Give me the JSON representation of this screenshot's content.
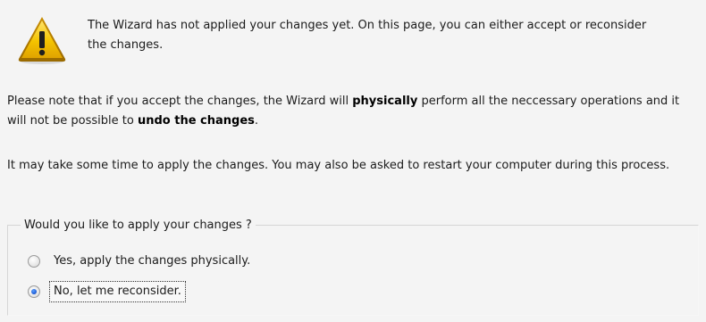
{
  "intro": {
    "text": "The Wizard has not applied your changes yet. On this page, you can either accept or reconsider the changes."
  },
  "note": {
    "part1": "Please note that if you accept the changes, the Wizard will ",
    "bold1": "physically",
    "part2": " perform all the neccessary operations and it will not be possible to ",
    "bold2": "undo the changes",
    "part3": "."
  },
  "info": {
    "text": "It may take some time to apply the changes. You may also be asked to restart your computer during this process."
  },
  "apply_group": {
    "legend": "Would you like to apply your changes ?",
    "options": [
      {
        "label": "Yes, apply the changes physically.",
        "selected": false
      },
      {
        "label": "No, let me reconsider.",
        "selected": true
      }
    ]
  },
  "colors": {
    "background": "#f4f4f4",
    "warning_yellow": "#f5c400",
    "radio_selected": "#1e5bd6"
  }
}
